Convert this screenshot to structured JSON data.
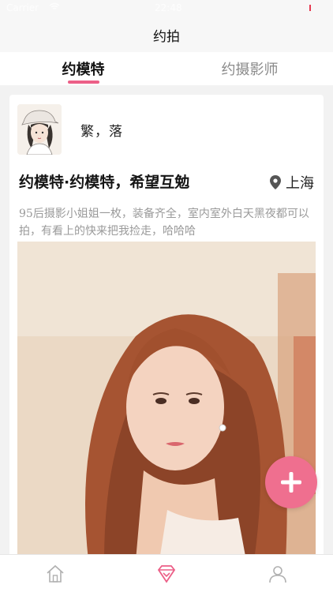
{
  "status_bar": {
    "carrier": "Carrier",
    "time": "22:48"
  },
  "nav": {
    "title": "约拍"
  },
  "tabs": [
    {
      "label": "约模特",
      "active": true
    },
    {
      "label": "约摄影师",
      "active": false
    }
  ],
  "post": {
    "author_name": "繁，落",
    "title": "约模特·约模特，希望互勉",
    "location": "上海",
    "description": "95后摄影小姐姐一枚，装备齐全，室内室外白天黑夜都可以拍，有看上的快来把我捡走，哈哈哈"
  },
  "fab": {
    "icon": "plus-icon"
  },
  "bottom_nav": [
    {
      "icon": "home-icon",
      "active": false
    },
    {
      "icon": "diamond-icon",
      "active": true
    },
    {
      "icon": "user-icon",
      "active": false
    }
  ],
  "colors": {
    "accent": "#ec5f87",
    "fab": "#ef6f8f",
    "background": "#f2f2f2",
    "inactive_icon": "#b0b0b0"
  }
}
